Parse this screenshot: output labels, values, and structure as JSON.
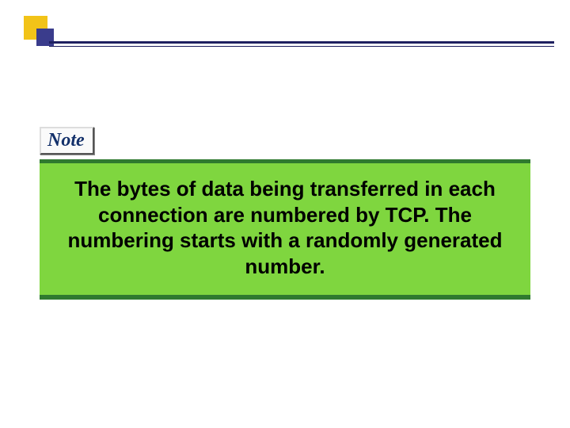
{
  "note": {
    "label": "Note",
    "body": "The bytes of data being transferred in each connection are numbered by TCP. The numbering starts with a randomly generated number."
  }
}
